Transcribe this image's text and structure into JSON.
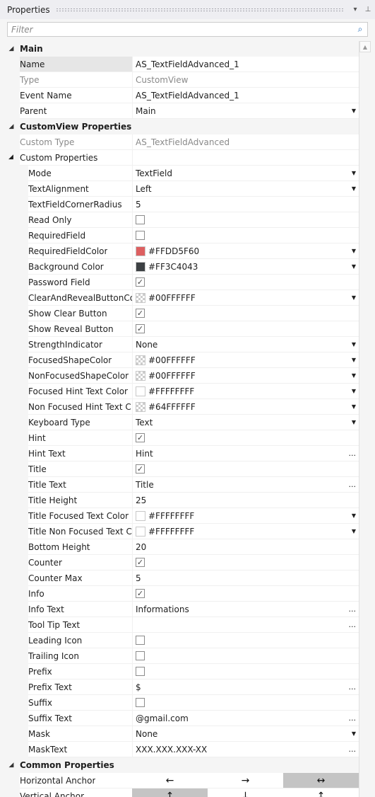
{
  "titlebar": {
    "title": "Properties",
    "dropdown_icon": "▾",
    "pin_icon": "⊥"
  },
  "filter": {
    "placeholder": "Filter",
    "search_icon": "⌕"
  },
  "sections": {
    "main": "Main",
    "customview": "CustomView Properties",
    "custom": "Custom Properties",
    "common": "Common Properties"
  },
  "main_rows": [
    {
      "name": "Name",
      "value": "AS_TextFieldAdvanced_1"
    },
    {
      "name": "Type",
      "value": "CustomView"
    },
    {
      "name": "Event Name",
      "value": "AS_TextFieldAdvanced_1"
    },
    {
      "name": "Parent",
      "value": "Main"
    }
  ],
  "cv_rows": [
    {
      "name": "Custom Type",
      "value": "AS_TextFieldAdvanced"
    }
  ],
  "custom_rows": [
    {
      "name": "Mode",
      "value": "TextField"
    },
    {
      "name": "TextAlignment",
      "value": "Left"
    },
    {
      "name": "TextFieldCornerRadius",
      "value": "5"
    },
    {
      "name": "Read Only"
    },
    {
      "name": "RequiredField"
    },
    {
      "name": "RequiredFieldColor",
      "value": "#FFDD5F60",
      "swatch": "#dd5f60"
    },
    {
      "name": "Background Color",
      "value": "#FF3C4043",
      "swatch": "#3c4043"
    },
    {
      "name": "Password Field",
      "checkmark": "✓"
    },
    {
      "name": "ClearAndRevealButtonCo...",
      "value": "#00FFFFFF"
    },
    {
      "name": "Show Clear Button",
      "checkmark": "✓"
    },
    {
      "name": "Show Reveal Button",
      "checkmark": "✓"
    },
    {
      "name": "StrengthIndicator",
      "value": "None"
    },
    {
      "name": "FocusedShapeColor",
      "value": "#00FFFFFF"
    },
    {
      "name": "NonFocusedShapeColor",
      "value": "#00FFFFFF"
    },
    {
      "name": "Focused Hint Text Color",
      "value": "#FFFFFFFF",
      "swatch": "#ffffff"
    },
    {
      "name": "Non Focused Hint Text C...",
      "value": "#64FFFFFF"
    },
    {
      "name": "Keyboard Type",
      "value": "Text"
    },
    {
      "name": "Hint",
      "checkmark": "✓"
    },
    {
      "name": "Hint Text",
      "value": "Hint"
    },
    {
      "name": "Title",
      "checkmark": "✓"
    },
    {
      "name": "Title Text",
      "value": "Title"
    },
    {
      "name": "Title Height",
      "value": "25"
    },
    {
      "name": "Title Focused Text Color",
      "value": "#FFFFFFFF",
      "swatch": "#ffffff"
    },
    {
      "name": "Title Non Focused Text C...",
      "value": "#FFFFFFFF",
      "swatch": "#ffffff"
    },
    {
      "name": "Bottom Height",
      "value": "20"
    },
    {
      "name": "Counter",
      "checkmark": "✓"
    },
    {
      "name": "Counter Max",
      "value": "5"
    },
    {
      "name": "Info",
      "checkmark": "✓"
    },
    {
      "name": "Info Text",
      "value": "Informations"
    },
    {
      "name": "Tool Tip Text"
    },
    {
      "name": "Leading Icon"
    },
    {
      "name": "Trailing Icon"
    },
    {
      "name": "Prefix"
    },
    {
      "name": "Prefix Text",
      "value": "$"
    },
    {
      "name": "Suffix"
    },
    {
      "name": "Suffix Text",
      "value": "@gmail.com"
    },
    {
      "name": "Mask",
      "value": "None"
    },
    {
      "name": "MaskText",
      "value": "XXX.XXX.XXX-XX"
    }
  ],
  "common_rows": [
    {
      "name": "Horizontal Anchor",
      "arrows": [
        "←",
        "→",
        "↔"
      ]
    },
    {
      "name": "Vertical Anchor",
      "arrows": [
        "↑",
        "↓",
        "↕"
      ]
    }
  ],
  "glyphs": {
    "dropdown": "▼",
    "ellipsis": "...",
    "expanded": "◢"
  },
  "colors": {
    "accent": "#1e6ab8",
    "selected_row": "#e6e6e6",
    "disabled_text": "#8a8a8a"
  }
}
